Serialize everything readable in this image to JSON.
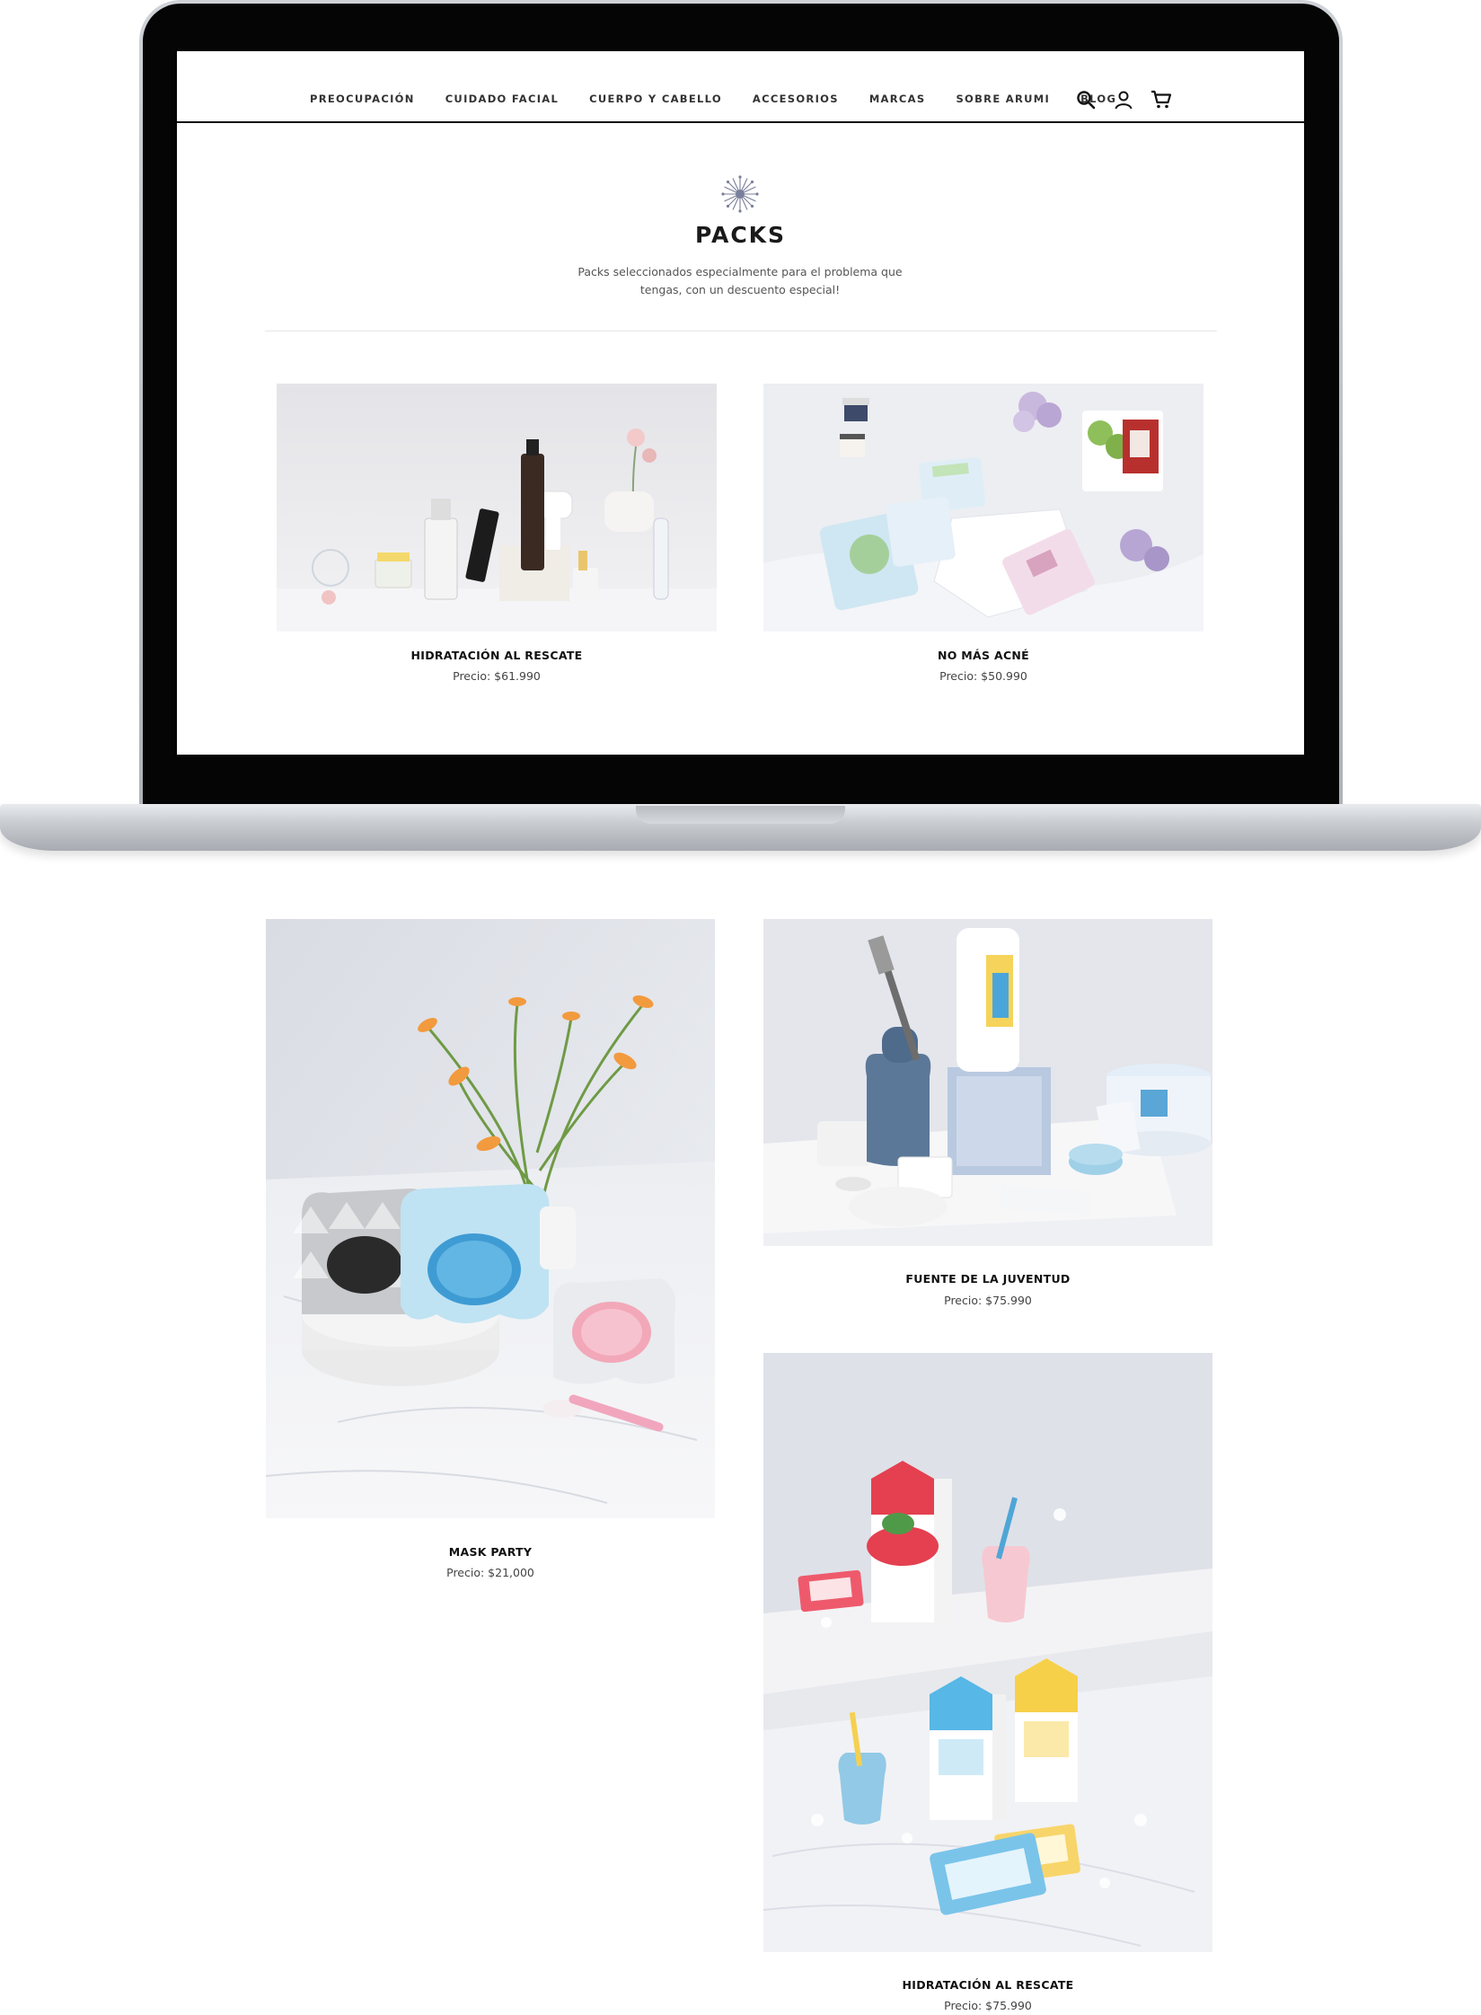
{
  "nav": {
    "items": [
      {
        "label": "PREOCUPACIÓN"
      },
      {
        "label": "CUIDADO FACIAL"
      },
      {
        "label": "CUERPO Y CABELLO"
      },
      {
        "label": "ACCESORIOS"
      },
      {
        "label": "MARCAS"
      },
      {
        "label": "SOBRE ARUMI"
      },
      {
        "label": "BLOG"
      }
    ],
    "icons": [
      "search-icon",
      "user-icon",
      "cart-icon"
    ]
  },
  "header": {
    "logo_icon": "flower-logo-icon",
    "title": "PACKS",
    "subtitle": "Packs seleccionados especialmente para el problema que tengas, con un descuento especial!"
  },
  "products": [
    {
      "name": "HIDRATACIÓN AL RESCATE",
      "price": "Precio: $61.990"
    },
    {
      "name": "NO MÁS ACNÉ",
      "price": "Precio: $50.990"
    },
    {
      "name": "MASK PARTY",
      "price": "Precio: $21,000"
    },
    {
      "name": "FUENTE DE LA JUVENTUD",
      "price": "Precio: $75.990"
    },
    {
      "name": "HIDRATACIÓN AL RESCATE",
      "price": "Precio: $75.990"
    }
  ],
  "colors": {
    "text": "#111111",
    "muted": "#555555",
    "bezel": "#050505",
    "aluminium": "#c9ccd1"
  }
}
